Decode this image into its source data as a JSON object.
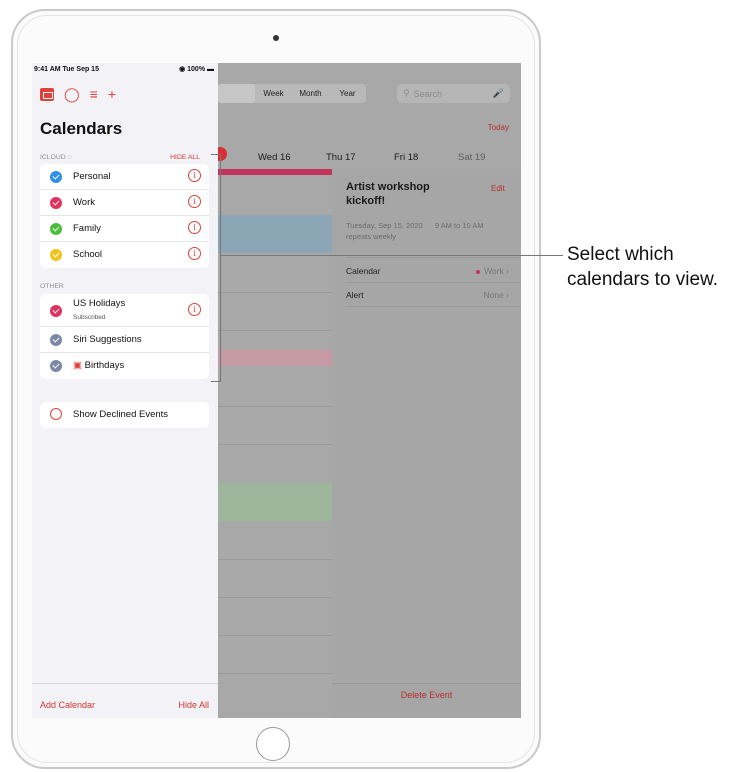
{
  "status_bar": {
    "time": "9:41 AM  Tue Sep 15",
    "battery": "◉ 100% ▬"
  },
  "background_app": {
    "view_tabs": [
      "",
      "Week",
      "Month",
      "Year"
    ],
    "search_placeholder": "Search",
    "today": "Today",
    "days": [
      "Wed 16",
      "Thu 17",
      "Fri 18",
      "Sat 19"
    ],
    "event": {
      "title": "Artist workshop kickoff!",
      "edit": "Edit",
      "date": "Tuesday, Sep 15, 2020",
      "time": "9 AM to 10 AM",
      "repeat": "repeats weekly",
      "calendar_label": "Calendar",
      "calendar_value": "Work",
      "alert_label": "Alert",
      "alert_value": "None",
      "delete": "Delete Event"
    }
  },
  "sidebar": {
    "title": "Calendars",
    "icloud_label": "ICLOUD",
    "hide_all_top": "HIDE ALL",
    "icloud_items": [
      {
        "label": "Personal",
        "color": "#2f8ee6"
      },
      {
        "label": "Work",
        "color": "#e0305e"
      },
      {
        "label": "Family",
        "color": "#4cbd3b"
      },
      {
        "label": "School",
        "color": "#f2c41a"
      }
    ],
    "other_label": "OTHER",
    "other_items": [
      {
        "label": "US Holidays",
        "sublabel": "Subscribed",
        "color": "#e0305e"
      },
      {
        "label": "Siri Suggestions",
        "color": "#7a8aa6"
      },
      {
        "label": "Birthdays",
        "color": "#7a8aa6"
      }
    ],
    "show_declined": "Show Declined Events",
    "add_calendar": "Add Calendar",
    "hide_all_bottom": "Hide All"
  },
  "callout": {
    "line1": "Select which",
    "line2": "calendars to view."
  },
  "icons": [
    "calendar-icon",
    "inbox-icon",
    "list-icon",
    "plus-icon",
    "info-icon",
    "gift-icon",
    "checkmark-icon",
    "mic-icon",
    "search-icon"
  ]
}
